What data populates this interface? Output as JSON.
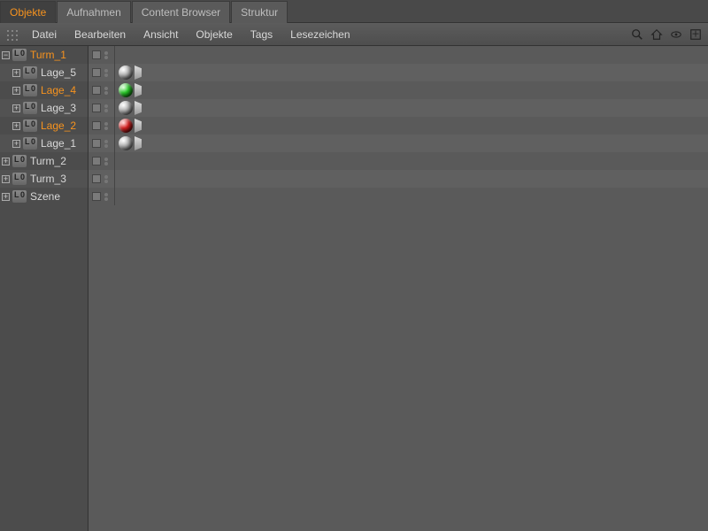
{
  "tabs": [
    {
      "label": "Objekte",
      "active": true
    },
    {
      "label": "Aufnahmen",
      "active": false
    },
    {
      "label": "Content Browser",
      "active": false
    },
    {
      "label": "Struktur",
      "active": false
    }
  ],
  "menu": [
    "Datei",
    "Bearbeiten",
    "Ansicht",
    "Objekte",
    "Tags",
    "Lesezeichen"
  ],
  "toolbar_icons": [
    "search-icon",
    "home-icon",
    "eye-icon",
    "maximize-icon"
  ],
  "tree": [
    {
      "name": "Turm_1",
      "depth": 0,
      "expanded": true,
      "highlight": true,
      "tags": []
    },
    {
      "name": "Lage_5",
      "depth": 1,
      "expanded": false,
      "highlight": false,
      "tags": [
        "grey"
      ]
    },
    {
      "name": "Lage_4",
      "depth": 1,
      "expanded": false,
      "highlight": true,
      "tags": [
        "green"
      ]
    },
    {
      "name": "Lage_3",
      "depth": 1,
      "expanded": false,
      "highlight": false,
      "tags": [
        "grey"
      ]
    },
    {
      "name": "Lage_2",
      "depth": 1,
      "expanded": false,
      "highlight": true,
      "tags": [
        "red"
      ]
    },
    {
      "name": "Lage_1",
      "depth": 1,
      "expanded": false,
      "highlight": false,
      "tags": [
        "grey"
      ]
    },
    {
      "name": "Turm_2",
      "depth": 0,
      "expanded": false,
      "highlight": false,
      "tags": []
    },
    {
      "name": "Turm_3",
      "depth": 0,
      "expanded": false,
      "highlight": false,
      "tags": []
    },
    {
      "name": "Szene",
      "depth": 0,
      "expanded": false,
      "highlight": false,
      "tags": []
    }
  ],
  "expander_glyph": {
    "open": "−",
    "closed": "+"
  }
}
